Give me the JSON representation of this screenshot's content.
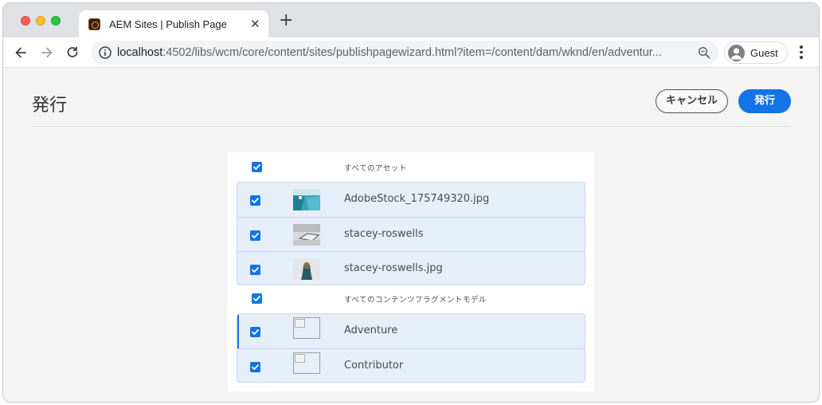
{
  "browser": {
    "tab_title": "AEM Sites | Publish Page",
    "tab_close": "✕",
    "new_tab": "+",
    "url_host": "localhost",
    "url_rest": ":4502/libs/wcm/core/content/sites/publishpagewizard.html?item=/content/dam/wknd/en/adventur...",
    "profile_label": "Guest"
  },
  "page": {
    "title": "発行",
    "cancel_label": "キャンセル",
    "publish_label": "発行"
  },
  "groups": [
    {
      "label": "すべてのアセット",
      "checked": true,
      "items": [
        {
          "label": "AdobeStock_175749320.jpg",
          "checked": true,
          "thumb": "pool-image"
        },
        {
          "label": "stacey-roswells",
          "checked": true,
          "thumb": "desk-image"
        },
        {
          "label": "stacey-roswells.jpg",
          "checked": true,
          "thumb": "person-image"
        }
      ]
    },
    {
      "label": "すべてのコンテンツフラグメントモデル",
      "checked": true,
      "items": [
        {
          "label": "Adventure",
          "checked": true,
          "thumb": "broken-image"
        },
        {
          "label": "Contributor",
          "checked": true,
          "thumb": "broken-image"
        }
      ]
    }
  ],
  "colors": {
    "accent": "#1473e6",
    "row_bg": "#e6eefa"
  }
}
